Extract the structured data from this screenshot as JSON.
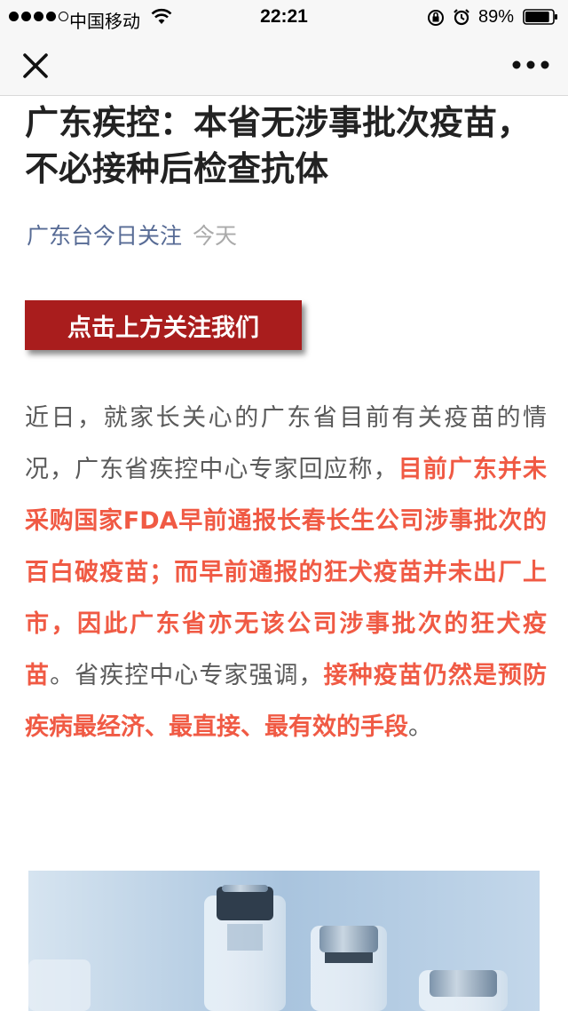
{
  "status_bar": {
    "carrier": "中国移动",
    "time": "22:21",
    "battery": "89%",
    "battery_level": 0.89
  },
  "nav": {
    "close_icon": "close-icon",
    "more_icon": "more-icon"
  },
  "article": {
    "title": "广东疾控：本省无涉事批次疫苗，不必接种后检查抗体",
    "account": "广东台今日关注",
    "date": "今天",
    "follow_banner": "点击上方关注我们",
    "body": {
      "p1": "近日，就家长关心的广东省目前有关疫苗的情况，广东省疾控中心专家回应称，",
      "h1": "目前广东并未采购国家FDA早前通报长春长生公司涉事批次的百白破疫苗；而早前通报的狂犬疫苗并未出厂上市，因此广东省亦无该公司涉事批次的狂犬疫苗",
      "p2": "。省疾控中心专家强调，",
      "h2": "接种疫苗仍然是预防疾病最经济、最直接、最有效的手段",
      "p3": "。"
    },
    "image": "vaccine-vials-image"
  },
  "colors": {
    "link": "#576b95",
    "highlight": "#f05a44",
    "banner": "#a91d1d"
  }
}
